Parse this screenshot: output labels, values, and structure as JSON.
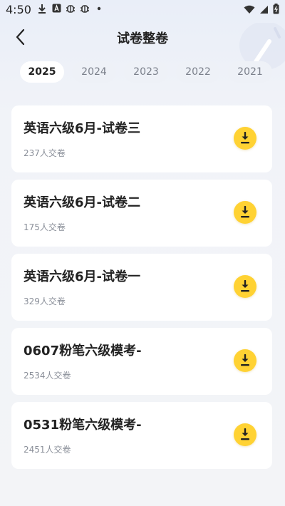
{
  "status_bar": {
    "time": "4:50",
    "icons_left": [
      "download-icon",
      "a-box-icon",
      "bug-icon",
      "bug-icon",
      "dot-icon"
    ],
    "icons_right": [
      "wifi-icon",
      "signal-icon",
      "battery-icon"
    ]
  },
  "header": {
    "title": "试卷整卷",
    "back_icon": "chevron-left-icon"
  },
  "tabs": [
    {
      "label": "2025",
      "active": true
    },
    {
      "label": "2024",
      "active": false
    },
    {
      "label": "2023",
      "active": false
    },
    {
      "label": "2022",
      "active": false
    },
    {
      "label": "2021",
      "active": false
    }
  ],
  "papers": [
    {
      "title": "英语六级6月-试卷三",
      "submissions": "237人交卷"
    },
    {
      "title": "英语六级6月-试卷二",
      "submissions": "175人交卷"
    },
    {
      "title": "英语六级6月-试卷一",
      "submissions": "329人交卷"
    },
    {
      "title": "0607粉笔六级模考-",
      "submissions": "2534人交卷"
    },
    {
      "title": "0531粉笔六级模考-",
      "submissions": "2451人交卷"
    }
  ],
  "colors": {
    "accent": "#ffd233",
    "background": "#f3f4f7",
    "card": "#ffffff"
  }
}
